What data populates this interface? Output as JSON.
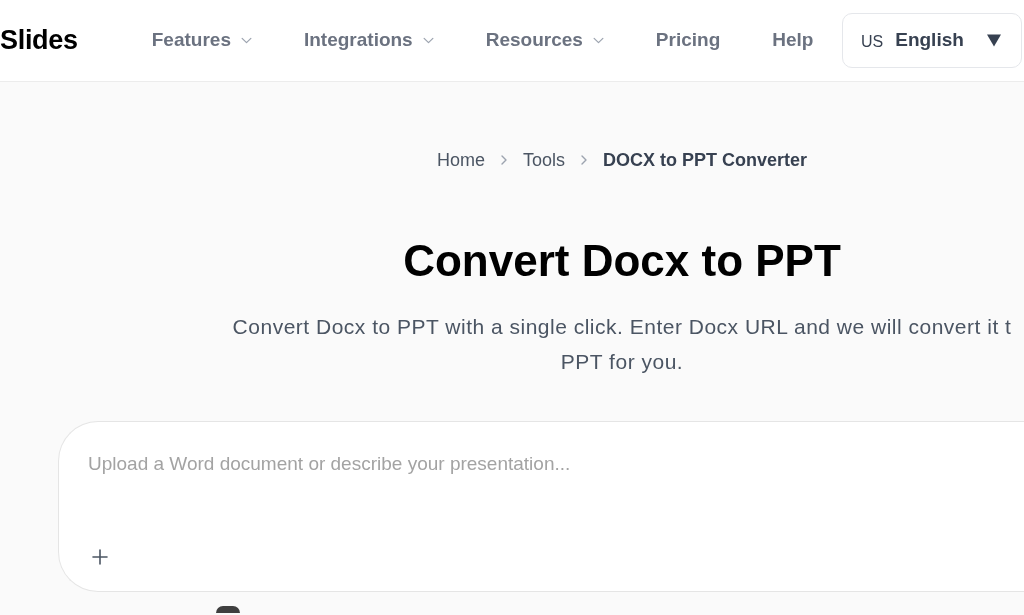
{
  "header": {
    "logo": "Slides",
    "nav": [
      {
        "label": "Features",
        "kind": "menu"
      },
      {
        "label": "Integrations",
        "kind": "menu"
      },
      {
        "label": "Resources",
        "kind": "menu"
      },
      {
        "label": "Pricing",
        "kind": "link"
      },
      {
        "label": "Help",
        "kind": "link"
      }
    ],
    "language": {
      "region": "US",
      "label": "English"
    }
  },
  "breadcrumb": [
    {
      "label": "Home",
      "current": false
    },
    {
      "label": "Tools",
      "current": false
    },
    {
      "label": "DOCX to PPT Converter",
      "current": true
    }
  ],
  "heading": "Convert Docx to PPT",
  "description_lines": [
    "Convert Docx to PPT with a single click. Enter Docx URL and we will convert it t",
    "PPT for you."
  ],
  "prompt": {
    "placeholder": "Upload a Word document or describe your presentation..."
  }
}
